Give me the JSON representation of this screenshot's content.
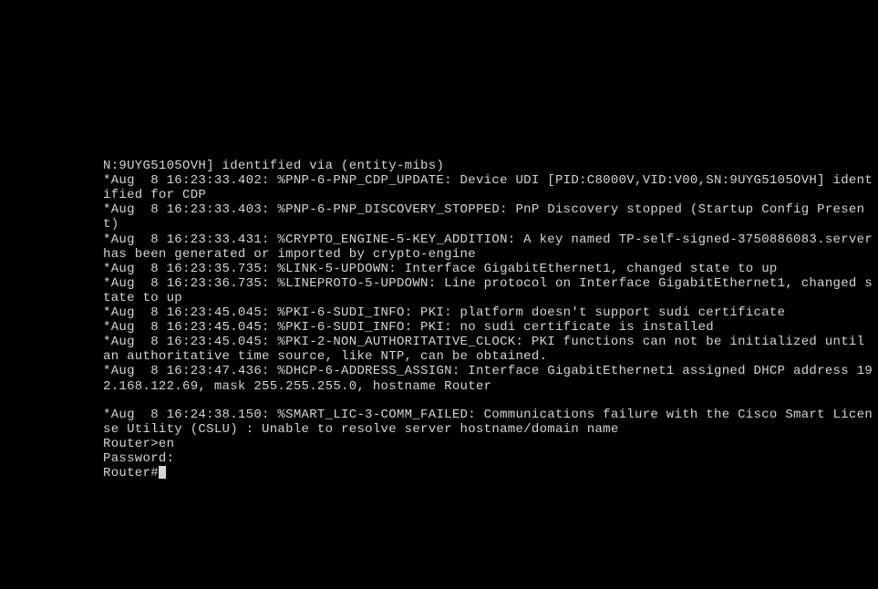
{
  "lines": [
    "N:9UYG5105OVH] identified via (entity-mibs)",
    "*Aug  8 16:23:33.402: %PNP-6-PNP_CDP_UPDATE: Device UDI [PID:C8000V,VID:V00,SN:9UYG5105OVH] identified for CDP",
    "*Aug  8 16:23:33.403: %PNP-6-PNP_DISCOVERY_STOPPED: PnP Discovery stopped (Startup Config Present)",
    "*Aug  8 16:23:33.431: %CRYPTO_ENGINE-5-KEY_ADDITION: A key named TP-self-signed-3750886083.server has been generated or imported by crypto-engine",
    "*Aug  8 16:23:35.735: %LINK-5-UPDOWN: Interface GigabitEthernet1, changed state to up",
    "*Aug  8 16:23:36.735: %LINEPROTO-5-UPDOWN: Line protocol on Interface GigabitEthernet1, changed state to up",
    "*Aug  8 16:23:45.045: %PKI-6-SUDI_INFO: PKI: platform doesn't support sudi certificate",
    "*Aug  8 16:23:45.045: %PKI-6-SUDI_INFO: PKI: no sudi certificate is installed",
    "*Aug  8 16:23:45.045: %PKI-2-NON_AUTHORITATIVE_CLOCK: PKI functions can not be initialized until an authoritative time source, like NTP, can be obtained.",
    "*Aug  8 16:23:47.436: %DHCP-6-ADDRESS_ASSIGN: Interface GigabitEthernet1 assigned DHCP address 192.168.122.69, mask 255.255.255.0, hostname Router",
    "",
    "*Aug  8 16:24:38.150: %SMART_LIC-3-COMM_FAILED: Communications failure with the Cisco Smart License Utility (CSLU) : Unable to resolve server hostname/domain name",
    "Router>en",
    "Password:"
  ],
  "current_prompt": "Router#"
}
